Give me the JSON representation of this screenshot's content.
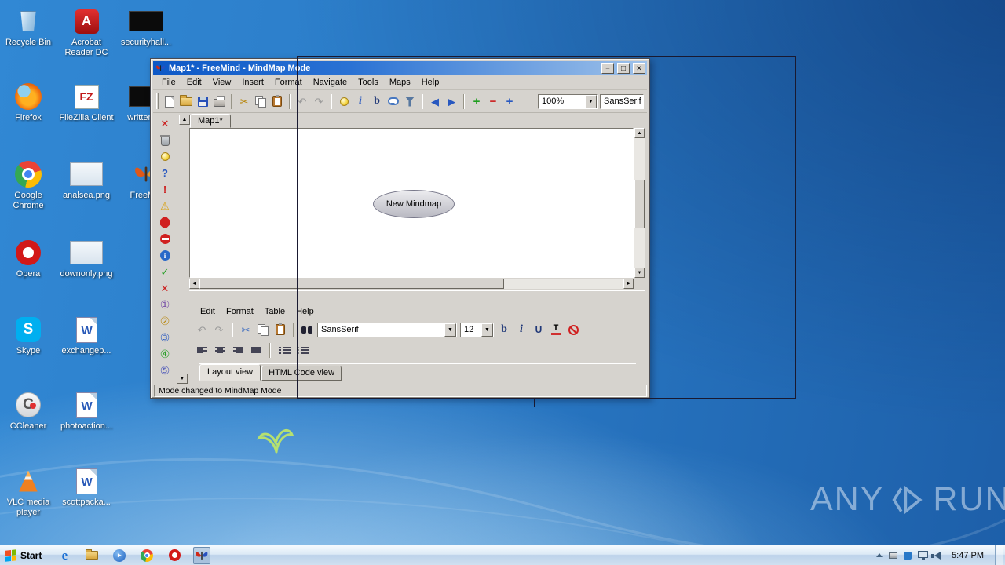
{
  "desktop": {
    "icons": [
      {
        "id": "recycle-bin",
        "label": "Recycle Bin"
      },
      {
        "id": "acrobat-reader",
        "label": "Acrobat Reader DC"
      },
      {
        "id": "securityhall",
        "label": "securityhall..."
      },
      {
        "id": "firefox",
        "label": "Firefox"
      },
      {
        "id": "filezilla",
        "label": "FileZilla Client"
      },
      {
        "id": "writtenp",
        "label": "writtenP..."
      },
      {
        "id": "google-chrome",
        "label": "Google Chrome"
      },
      {
        "id": "analsea-png",
        "label": "analsea.png"
      },
      {
        "id": "freemind",
        "label": "FreeM..."
      },
      {
        "id": "opera",
        "label": "Opera"
      },
      {
        "id": "downonly-png",
        "label": "downonly.png"
      },
      {
        "id": "skype",
        "label": "Skype"
      },
      {
        "id": "exchangep",
        "label": "exchangep..."
      },
      {
        "id": "ccleaner",
        "label": "CCleaner"
      },
      {
        "id": "photoaction",
        "label": "photoaction..."
      },
      {
        "id": "vlc",
        "label": "VLC media player"
      },
      {
        "id": "scottpacka",
        "label": "scottpacka..."
      }
    ]
  },
  "freemind": {
    "title": "Map1* - FreeMind - MindMap Mode",
    "window_buttons": [
      "minimize",
      "maximize",
      "close"
    ],
    "menu": [
      "File",
      "Edit",
      "View",
      "Insert",
      "Format",
      "Navigate",
      "Tools",
      "Maps",
      "Help"
    ],
    "toolbar": {
      "icons": [
        "new-map",
        "open-map",
        "save-map",
        "print",
        "cut",
        "copy",
        "paste",
        "undo",
        "redo",
        "idea-bulb",
        "italic",
        "bold",
        "cloud-bubble",
        "filter",
        "back",
        "forward",
        "plus-green",
        "minus-red",
        "plus-blue"
      ],
      "zoom": "100%",
      "font": "SansSerif"
    },
    "left_toolbar_icons": [
      "remove",
      "trash",
      "idea-bulb",
      "help-question",
      "exclamation",
      "warning-triangle",
      "stop-sign",
      "no-entry",
      "info",
      "ok-check",
      "cancel-cross",
      "priority-1",
      "priority-2",
      "priority-3",
      "priority-4",
      "priority-5"
    ],
    "map_tab": "Map1*",
    "node": "New Mindmap",
    "note_editor": {
      "menu": [
        "Edit",
        "Format",
        "Table",
        "Help"
      ],
      "toolbar_icons": [
        "undo",
        "redo",
        "cut",
        "copy",
        "paste",
        "find-replace",
        "bold",
        "italic",
        "underline",
        "font-color",
        "remove-format",
        "align-left",
        "align-center",
        "align-right",
        "align-justify",
        "bullet-list",
        "numbered-list"
      ],
      "font": "SansSerif",
      "size": "12",
      "tabs": [
        "Layout view",
        "HTML Code view"
      ]
    },
    "status": "Mode changed to MindMap Mode"
  },
  "taskbar": {
    "start": "Start",
    "quick_launch": [
      "internet-explorer",
      "windows-explorer",
      "media-player",
      "chrome",
      "opera",
      "freemind"
    ],
    "tray_icons": [
      "expand",
      "device",
      "security",
      "network",
      "volume"
    ],
    "clock": "5:47 PM"
  },
  "watermark": {
    "left": "ANY",
    "right": "RUN"
  }
}
